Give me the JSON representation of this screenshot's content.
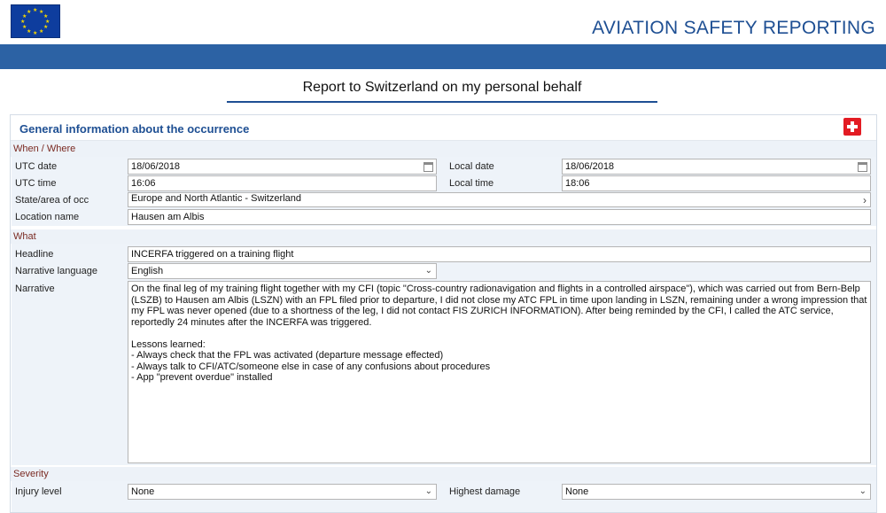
{
  "header": {
    "app_title": "AVIATION SAFETY REPORTING",
    "logo_icon": "eu-flag-icon"
  },
  "page": {
    "title": "Report to Switzerland on my personal behalf"
  },
  "panel": {
    "title": "General information about the occurrence",
    "flag_icon": "swiss-flag-icon"
  },
  "when_where": {
    "section_label": "When / Where",
    "utc_date_label": "UTC date",
    "utc_date": "18/06/2018",
    "local_date_label": "Local date",
    "local_date": "18/06/2018",
    "utc_time_label": "UTC time",
    "utc_time": "16:06",
    "local_time_label": "Local time",
    "local_time": "18:06",
    "state_label": "State/area of occ",
    "state": "Europe and North Atlantic - Switzerland",
    "location_label": "Location name",
    "location": "Hausen am Albis"
  },
  "what": {
    "section_label": "What",
    "headline_label": "Headline",
    "headline": "INCERFA triggered on a training flight",
    "language_label": "Narrative language",
    "language": "English",
    "narrative_label": "Narrative",
    "narrative": "On the final leg of my training flight together with my CFI (topic \"Cross-country radionavigation and flights in a controlled airspace\"), which was carried out from Bern-Belp (LSZB) to Hausen am Albis (LSZN) with an FPL filed prior to departure, I did not close my ATC FPL in time upon landing in LSZN, remaining under a wrong impression that my FPL was never opened (due to a shortness of the leg, I did not contact FIS ZURICH INFORMATION). After being reminded by the CFI, I called the ATC service, reportedly 24 minutes after the INCERFA was triggered.\n\nLessons learned:\n- Always check that the FPL was activated (departure message effected)\n- Always talk to CFI/ATC/someone else in case of any confusions about procedures\n- App \"prevent overdue\" installed"
  },
  "severity": {
    "section_label": "Severity",
    "injury_label": "Injury level",
    "injury": "None",
    "damage_label": "Highest damage",
    "damage": "None"
  },
  "colors": {
    "brand_blue": "#2c62a4",
    "title_blue": "#1e4f93",
    "section_red": "#7a2a22",
    "swiss_red": "#e31b23"
  }
}
